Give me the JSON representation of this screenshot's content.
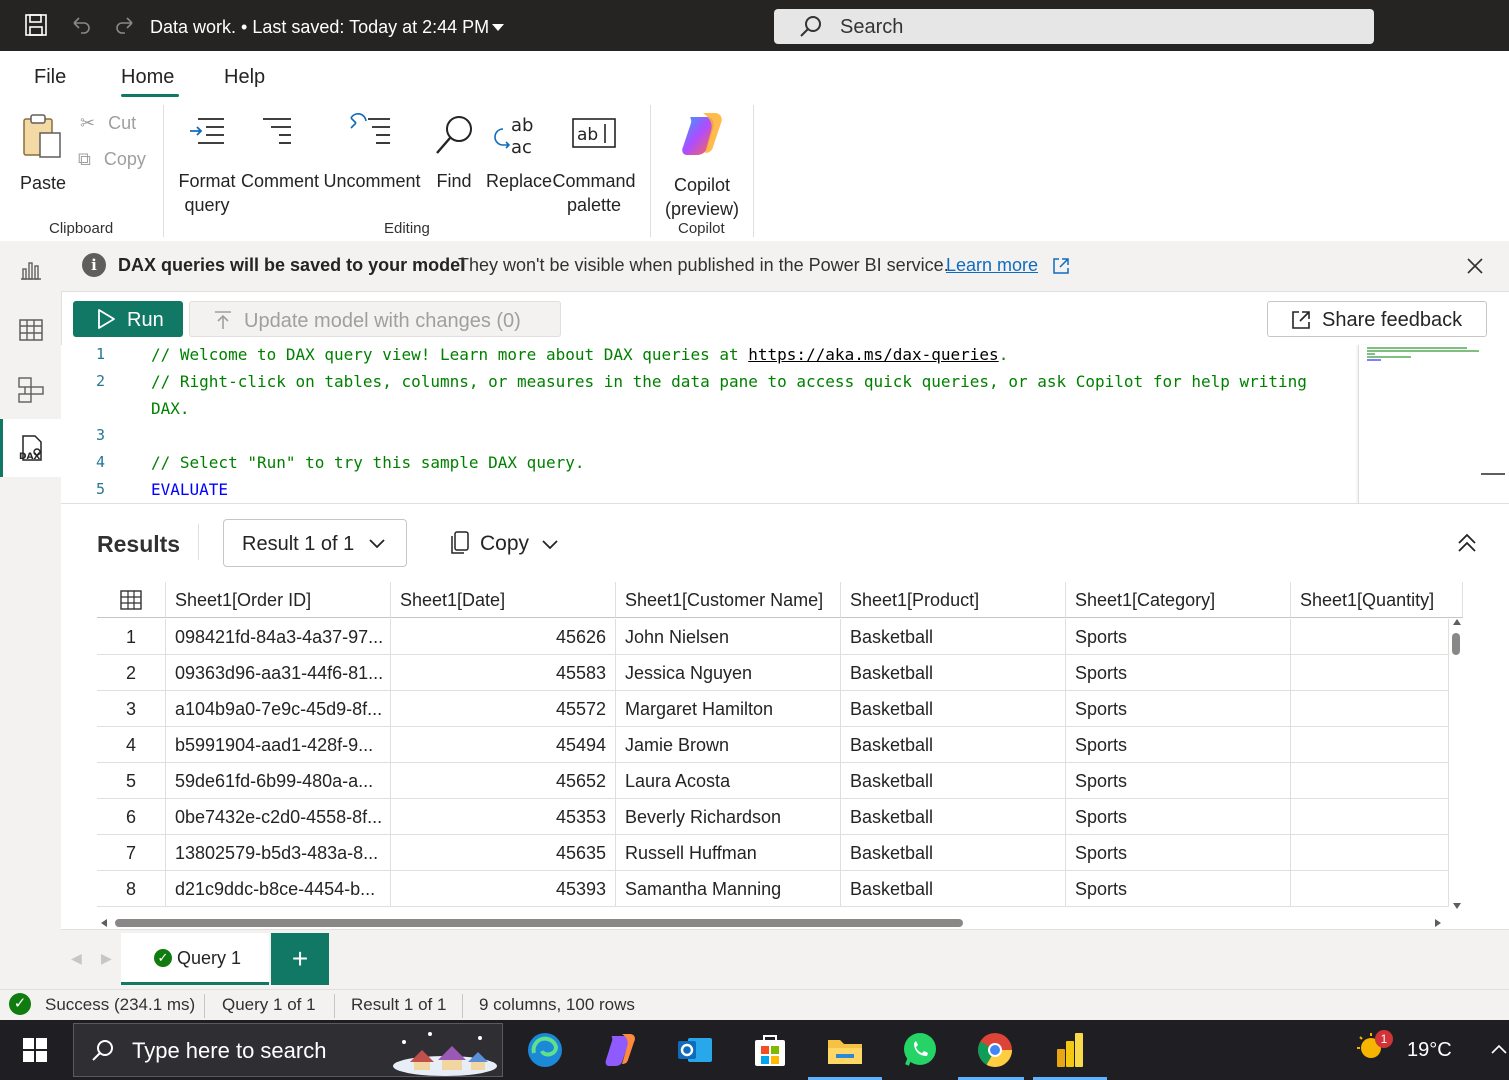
{
  "titlebar": {
    "doc_title": "Data work. • Last saved: Today at 2:44 PM",
    "search_placeholder": "Search"
  },
  "ribbon": {
    "tabs": [
      "File",
      "Home",
      "Help"
    ],
    "active_tab": "Home",
    "clipboard": {
      "paste": "Paste",
      "cut": "Cut",
      "copy": "Copy",
      "group": "Clipboard"
    },
    "editing": {
      "format_l1": "Format",
      "format_l2": "query",
      "comment": "Comment",
      "uncomment": "Uncomment",
      "find": "Find",
      "replace": "Replace",
      "cmd_l1": "Command",
      "cmd_l2": "palette",
      "group": "Editing"
    },
    "copilot": {
      "l1": "Copilot",
      "l2": "(preview)",
      "group": "Copilot"
    }
  },
  "banner": {
    "bold": "DAX queries will be saved to your model",
    "text": "They won't be visible when published in the Power BI service.",
    "link": "Learn more"
  },
  "toolbar": {
    "run": "Run",
    "update": "Update model with changes (0)",
    "share": "Share feedback"
  },
  "editor": {
    "line_numbers": [
      "1",
      "2",
      "3",
      "4",
      "5"
    ],
    "line1_prefix": "// Welcome to DAX query view! Learn more about DAX queries at ",
    "line1_link": "https://aka.ms/dax-queries",
    "line1_suffix": ".",
    "line2a": "// Right-click on tables, columns, or measures in the data pane to access quick queries, or ask Copilot for help writing",
    "line2b": "DAX.",
    "line4": "// Select \"Run\" to try this sample DAX query.",
    "line5": "EVALUATE"
  },
  "results": {
    "title": "Results",
    "result_selector": "Result 1 of 1",
    "copy": "Copy",
    "columns": [
      "Sheet1[Order ID]",
      "Sheet1[Date]",
      "Sheet1[Customer Name]",
      "Sheet1[Product]",
      "Sheet1[Category]",
      "Sheet1[Quantity]"
    ],
    "rows": [
      {
        "n": "1",
        "id": "098421fd-84a3-4a37-97...",
        "date": "45626",
        "name": "John Nielsen",
        "product": "Basketball",
        "category": "Sports"
      },
      {
        "n": "2",
        "id": "09363d96-aa31-44f6-81...",
        "date": "45583",
        "name": "Jessica Nguyen",
        "product": "Basketball",
        "category": "Sports"
      },
      {
        "n": "3",
        "id": "a104b9a0-7e9c-45d9-8f...",
        "date": "45572",
        "name": "Margaret Hamilton",
        "product": "Basketball",
        "category": "Sports"
      },
      {
        "n": "4",
        "id": "b5991904-aad1-428f-9...",
        "date": "45494",
        "name": "Jamie Brown",
        "product": "Basketball",
        "category": "Sports"
      },
      {
        "n": "5",
        "id": "59de61fd-6b99-480a-a...",
        "date": "45652",
        "name": "Laura Acosta",
        "product": "Basketball",
        "category": "Sports"
      },
      {
        "n": "6",
        "id": "0be7432e-c2d0-4558-8f...",
        "date": "45353",
        "name": "Beverly Richardson",
        "product": "Basketball",
        "category": "Sports"
      },
      {
        "n": "7",
        "id": "13802579-b5d3-483a-8...",
        "date": "45635",
        "name": "Russell Huffman",
        "product": "Basketball",
        "category": "Sports"
      },
      {
        "n": "8",
        "id": "d21c9ddc-b8ce-4454-b...",
        "date": "45393",
        "name": "Samantha Manning",
        "product": "Basketball",
        "category": "Sports"
      }
    ]
  },
  "query_tabs": {
    "tab1": "Query 1",
    "add": "+"
  },
  "statusbar": {
    "success": "Success (234.1 ms)",
    "query": "Query 1 of 1",
    "result": "Result 1 of 1",
    "shape": "9 columns, 100 rows"
  },
  "taskbar": {
    "search_placeholder": "Type here to search",
    "weather_temp": "19°C",
    "weather_badge": "1"
  },
  "colors": {
    "accent": "#117865",
    "titlebar": "#252423",
    "link": "#0f6cbd",
    "code_comment": "#008000",
    "code_keyword": "#0000ff",
    "line_number": "#237893"
  }
}
